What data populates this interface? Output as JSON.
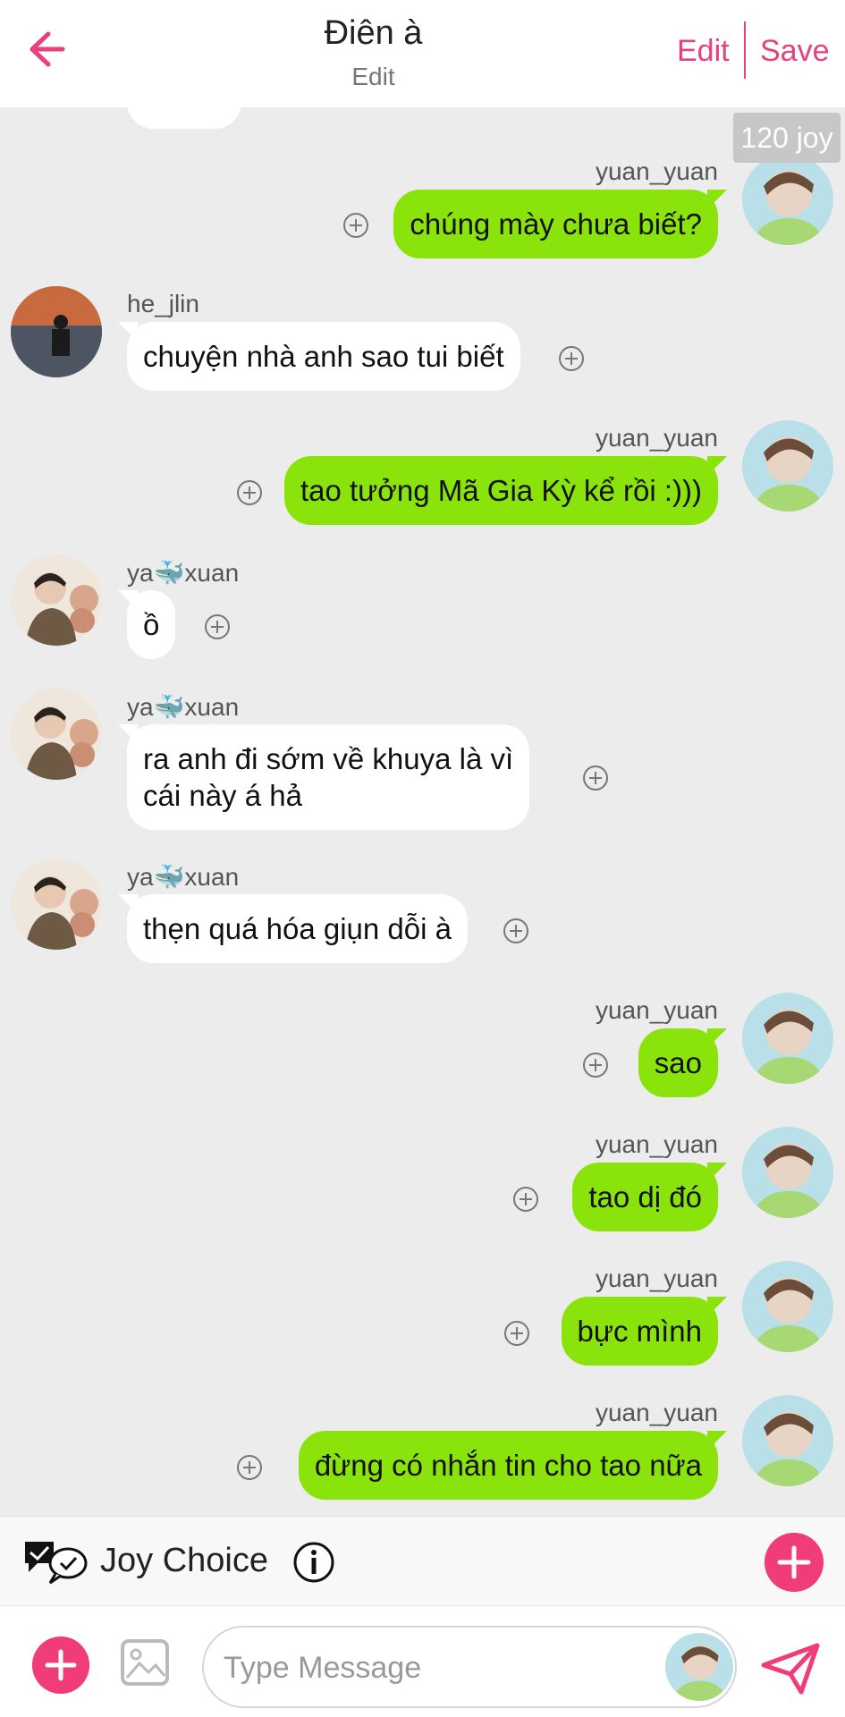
{
  "header": {
    "title": "Điên à",
    "subtitle": "Edit",
    "edit_label": "Edit",
    "save_label": "Save"
  },
  "chat": {
    "joy_badge": "120 joy",
    "messages": [
      {
        "sender": "yuan_yuan",
        "side": "right",
        "text": "chúng mày chưa biết?"
      },
      {
        "sender": "he_jlin",
        "side": "left",
        "text": "chuyện nhà anh sao tui biết"
      },
      {
        "sender": "yuan_yuan",
        "side": "right",
        "text": "tao tưởng Mã Gia Kỳ kể rồi :)))"
      },
      {
        "sender": "ya🐳xuan",
        "side": "left",
        "text": "ồ"
      },
      {
        "sender": "ya🐳xuan",
        "side": "left",
        "text_line1": "ra anh đi sớm về khuya là vì",
        "text_line2": "cái này á hả"
      },
      {
        "sender": "ya🐳xuan",
        "side": "left",
        "text": "thẹn quá hóa giụn dỗi à"
      },
      {
        "sender": "yuan_yuan",
        "side": "right",
        "text": "sao"
      },
      {
        "sender": "yuan_yuan",
        "side": "right",
        "text": "tao dị đó"
      },
      {
        "sender": "yuan_yuan",
        "side": "right",
        "text": "bực mình"
      },
      {
        "sender": "yuan_yuan",
        "side": "right",
        "text": "đừng có nhắn tin cho tao nữa"
      }
    ]
  },
  "joy_choice": {
    "label": "Joy Choice"
  },
  "composer": {
    "placeholder": "Type Message"
  },
  "colors": {
    "accent": "#f03c78",
    "outgoing_bubble": "#8ae40c",
    "incoming_bubble": "#ffffff",
    "background": "#ececec"
  },
  "icons": [
    "back-arrow-icon",
    "add-reaction-icon",
    "joy-choice-icon",
    "info-icon",
    "plus-icon",
    "image-icon",
    "send-icon"
  ]
}
